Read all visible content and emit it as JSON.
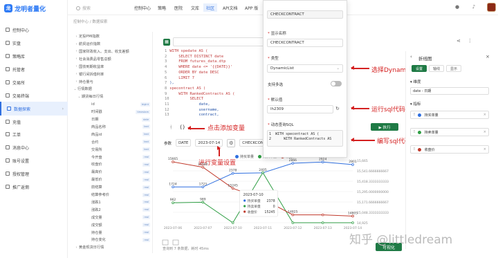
{
  "app": {
    "logo_text": "龙明者量化"
  },
  "sidebar": {
    "items": [
      {
        "label": "控制中心"
      },
      {
        "label": "实盘"
      },
      {
        "label": "策略库"
      },
      {
        "label": "托管者"
      },
      {
        "label": "交易所"
      },
      {
        "label": "交易终端"
      },
      {
        "label": "数据探索"
      },
      {
        "label": "充值"
      },
      {
        "label": "工单"
      },
      {
        "label": "消息中心"
      },
      {
        "label": "账号设置"
      },
      {
        "label": "授权管理"
      },
      {
        "label": "推广返佣"
      }
    ]
  },
  "topbar": {
    "search_placeholder": "搜索",
    "nav": [
      "控制中心",
      "策略",
      "医院",
      "文库",
      "社区",
      "API文档",
      "APP 版"
    ]
  },
  "breadcrumb": "控制中心  /  数据探索",
  "tree": {
    "items": [
      {
        "label": "定投PMI指数",
        "caret": "›",
        "badge": ""
      },
      {
        "label": "航贸运价指数",
        "caret": "›",
        "badge": ""
      },
      {
        "label": "国家财政收入、支出、收支差额",
        "caret": "›",
        "badge": ""
      },
      {
        "label": "社会消费品零售总额",
        "caret": "›",
        "badge": ""
      },
      {
        "label": "国债到期收益率",
        "caret": "›",
        "badge": ""
      },
      {
        "label": "银行间拆借利率",
        "caret": "›",
        "badge": ""
      },
      {
        "label": "持仓量与",
        "caret": "›",
        "badge": ""
      },
      {
        "label": "行情数据",
        "caret": "⌄",
        "badge": ""
      },
      {
        "label": "期货每日行情",
        "caret": "⌄",
        "badge": ""
      },
      {
        "label": "id",
        "caret": "",
        "badge": "bigint"
      },
      {
        "label": "时间戳",
        "caret": "",
        "badge": "timestam"
      },
      {
        "label": "日期",
        "caret": "",
        "badge": "date"
      },
      {
        "label": "商品名称",
        "caret": "",
        "badge": "text"
      },
      {
        "label": "商品id",
        "caret": "",
        "badge": "text"
      },
      {
        "label": "合约",
        "caret": "",
        "badge": "text"
      },
      {
        "label": "交易所",
        "caret": "",
        "badge": "text"
      },
      {
        "label": "今开盘",
        "caret": "",
        "badge": "real"
      },
      {
        "label": "收盘价",
        "caret": "",
        "badge": "real"
      },
      {
        "label": "最高价",
        "caret": "",
        "badge": "real"
      },
      {
        "label": "最低价",
        "caret": "",
        "badge": "real"
      },
      {
        "label": "前结算",
        "caret": "",
        "badge": "real"
      },
      {
        "label": "结算参考价",
        "caret": "",
        "badge": "real"
      },
      {
        "label": "涨跌1",
        "caret": "",
        "badge": "real"
      },
      {
        "label": "涨跌2",
        "caret": "",
        "badge": "real"
      },
      {
        "label": "成交量",
        "caret": "",
        "badge": "real"
      },
      {
        "label": "成交额",
        "caret": "",
        "badge": "real"
      },
      {
        "label": "持仓量",
        "caret": "",
        "badge": "real"
      },
      {
        "label": "持仓变化",
        "caret": "",
        "badge": "real"
      },
      {
        "label": "黄金现货日行情",
        "caret": "›",
        "badge": ""
      }
    ]
  },
  "editor": {
    "lines": [
      {
        "n": "1",
        "t": "WITH spedate AS ("
      },
      {
        "n": "2",
        "t": "    SELECT DISTINCT date"
      },
      {
        "n": "3",
        "t": "    FROM futures_data.dtp"
      },
      {
        "n": "4",
        "t": "    WHERE date <= '{{DATE}}'"
      },
      {
        "n": "5",
        "t": "    ORDER BY date DESC"
      },
      {
        "n": "6",
        "t": "    LIMIT 7"
      },
      {
        "n": "7",
        "t": "),"
      },
      {
        "n": "8",
        "t": "specontract AS ("
      },
      {
        "n": "9",
        "t": "    WITH RankedContracts AS ("
      },
      {
        "n": "10",
        "t": "        SELECT"
      },
      {
        "n": "11",
        "t": "            date,"
      },
      {
        "n": "12",
        "t": "            username,"
      },
      {
        "n": "13",
        "t": "            contract,"
      }
    ]
  },
  "params": {
    "label": "参数",
    "date_name": "DATE",
    "date_value": "2023-07-14",
    "contract_name": "CHECKCONTRACT"
  },
  "annotations": {
    "add_variable": "点击添加变量",
    "variable_settings": "进行变量设置",
    "select_dynamic": "选择DynamicList",
    "run_sql": "运行sql代码获取选项",
    "write_sql": "编写sql代码"
  },
  "popup": {
    "top_value": "CHECKCONTRACT",
    "display_name_label": "显示名称",
    "display_name_value": "CHECKCONTRACT",
    "type_label": "类型",
    "type_value": "DynamicList",
    "multi_label": "支持多选",
    "default_label": "默认值",
    "default_value": "lh2309",
    "sql_label": "动态查询SQL",
    "sql_lines": [
      "1  WITH specontract AS (",
      "2      WITH RankedContracts AS"
    ]
  },
  "exec_button": "▶ 执行",
  "right_panel": {
    "title": "折线图",
    "tabs": [
      "设置",
      "轴线",
      "显示"
    ],
    "dimension_label": "维度",
    "dimension_value": "date - 日期",
    "metric_label": "指标",
    "series": [
      {
        "name": "持买单量",
        "color": "#2f6fe0"
      },
      {
        "name": "持卖单量",
        "color": "#2f9e44"
      },
      {
        "name": "收盘价",
        "color": "#c0392b"
      }
    ]
  },
  "chart_data": {
    "type": "line",
    "x": [
      "2023-07-06",
      "2023-07-07",
      "2023-07-10",
      "2023-07-11",
      "2023-07-12",
      "2023-07-13",
      "2023-07-14"
    ],
    "series": [
      {
        "name": "持买单量",
        "color": "#2f6fe0",
        "values": [
          1724,
          1723,
          2378,
          2405,
          2866,
          2924,
          2801
        ]
      },
      {
        "name": "持卖单量",
        "color": "#2f9e44",
        "values": [
          962,
          989,
          0,
          2415,
          0,
          0,
          0
        ]
      },
      {
        "name": "收盘价",
        "color": "#c0392b",
        "values": [
          15665,
          15580,
          15245,
          15075,
          14825,
          14825,
          14805
        ]
      }
    ],
    "left_ticks": [
      "3,000",
      "2,500",
      "2,000",
      "1,500",
      "1,000",
      "500",
      "0"
    ],
    "right_ticks": [
      "15,665",
      "15,541.6666666667",
      "15,418.3333333333",
      "15,295.0000000000",
      "15,171.6666666667",
      "15,048.3333333333",
      "14,925"
    ],
    "data_labels_blue": [
      "1724",
      "1723",
      "2378",
      "2405",
      "2866",
      "2924",
      "2801"
    ],
    "data_labels_green": [
      "962",
      "989"
    ],
    "data_labels_red": [
      "15665",
      "15580",
      "15245",
      "15075",
      "14825",
      "14805"
    ],
    "tooltip": {
      "date": "2023-07-10",
      "rows": [
        {
          "name": "持买单量",
          "value": "2378"
        },
        {
          "name": "持卖单量",
          "value": "0"
        },
        {
          "name": "收盘价",
          "value": "15245"
        }
      ]
    }
  },
  "status_text": "查询到 7 条数据，耗时 45ms",
  "bottom_button": "可视化",
  "watermark": "知乎 @littledream"
}
